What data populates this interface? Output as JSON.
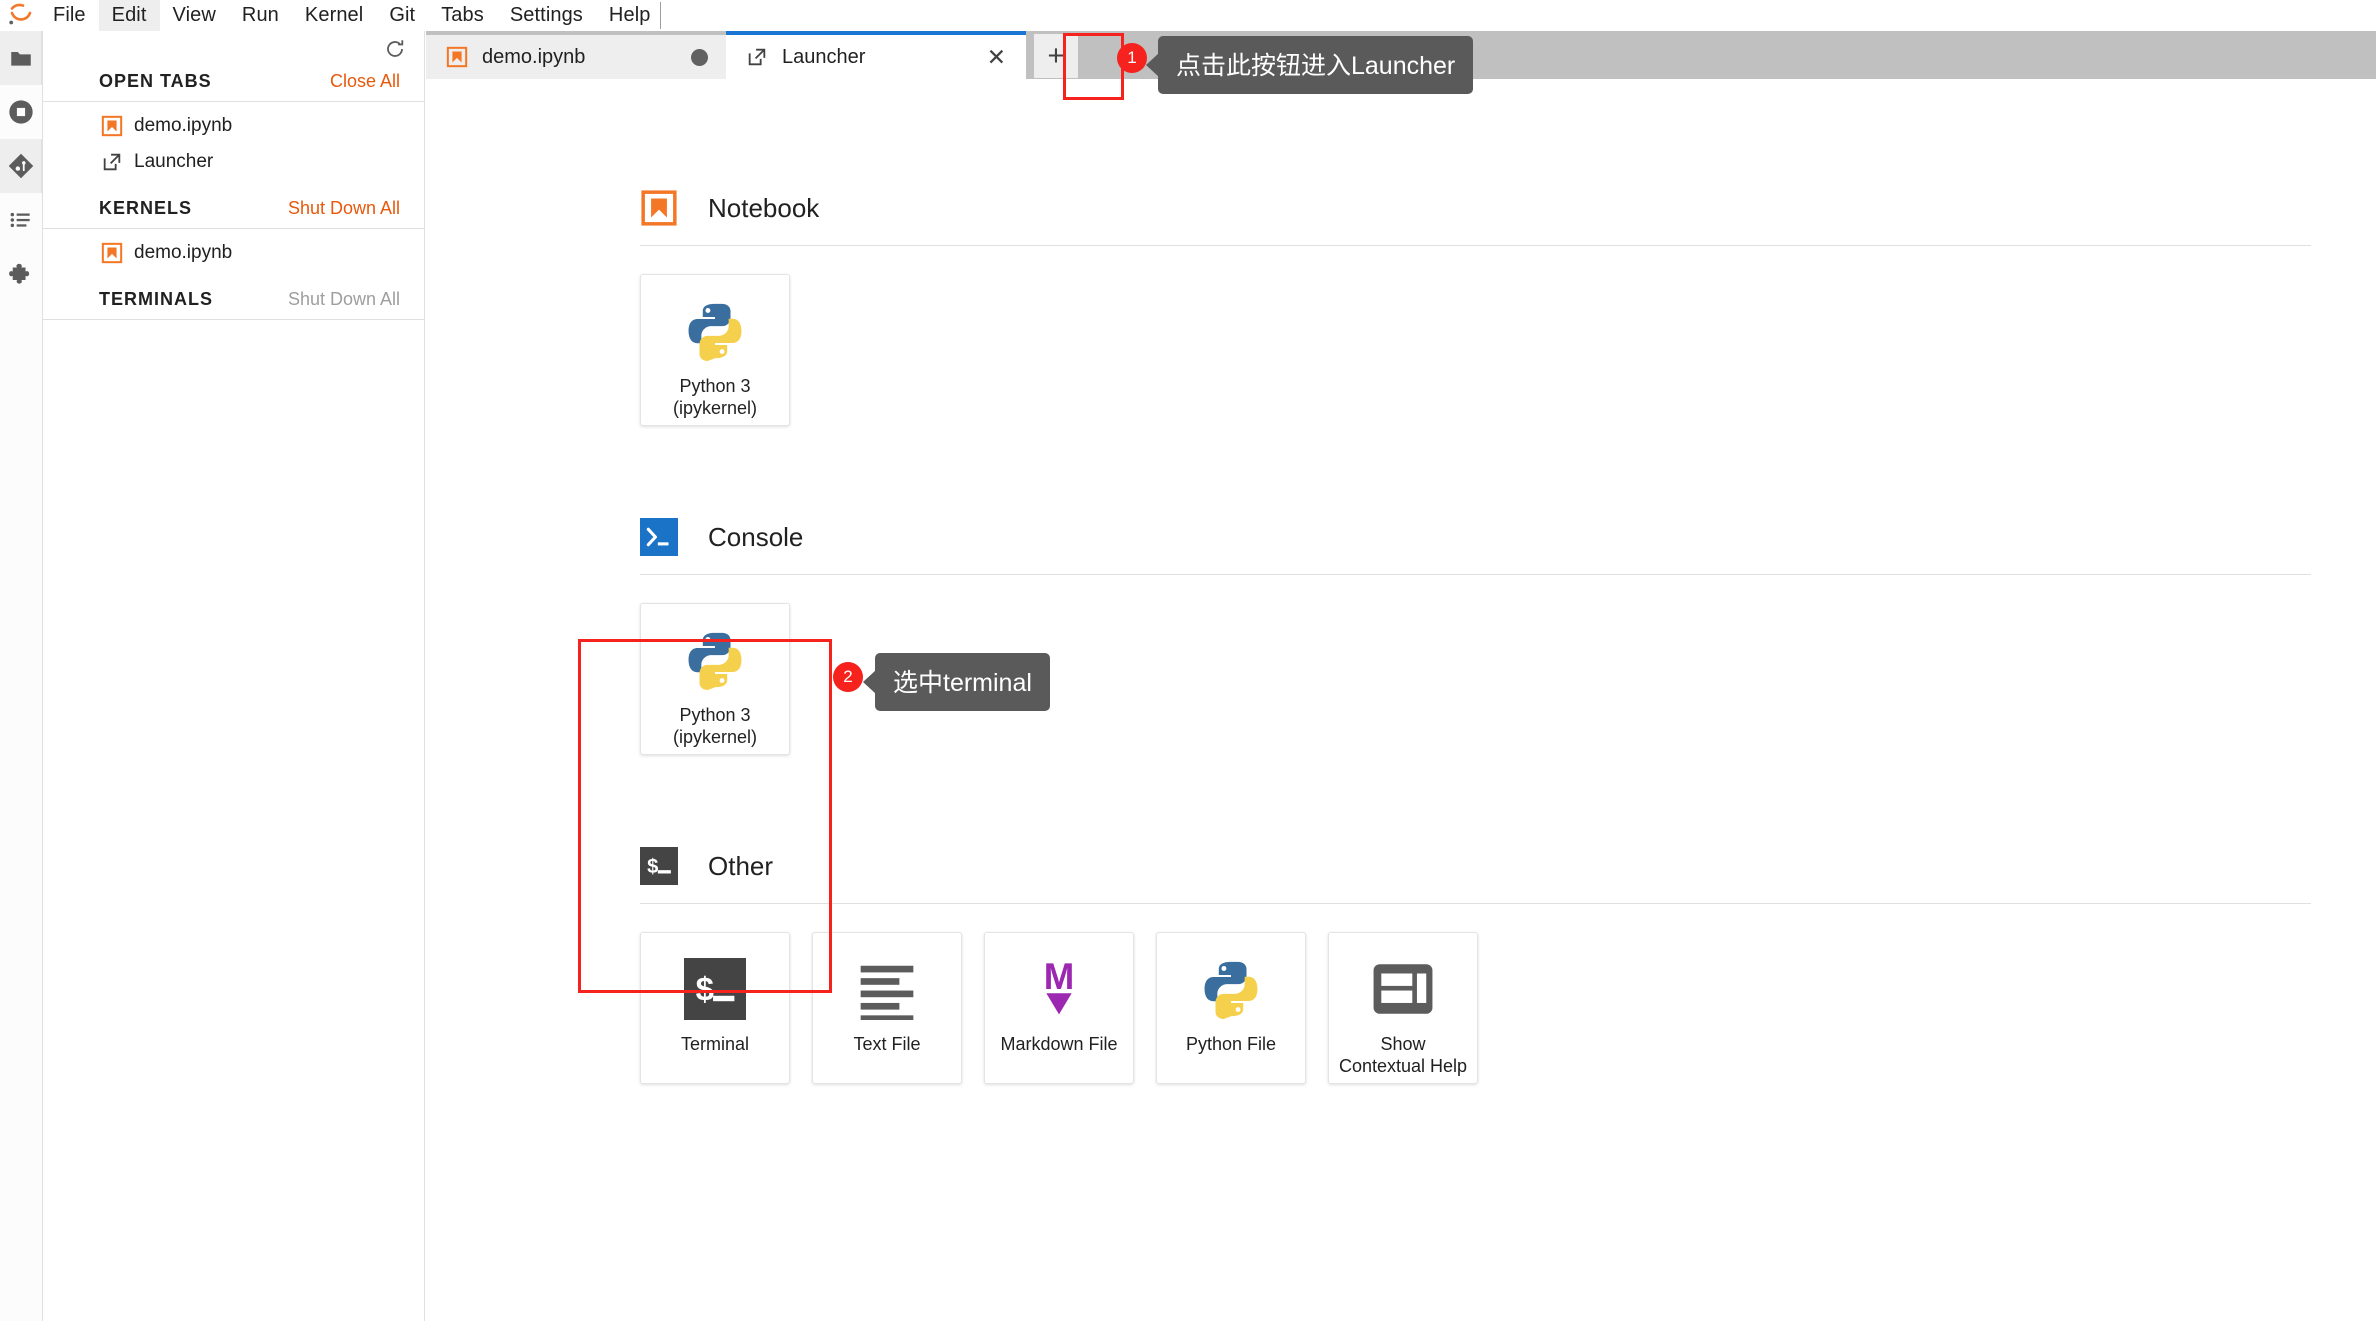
{
  "app": {
    "logo_icon": "jupyter-logo-icon",
    "accent_color": "#e8590c",
    "tab_active_color": "#1976d2",
    "annotation_color": "#f5221e"
  },
  "menubar": {
    "items": [
      {
        "label": "File",
        "name": "menu-file",
        "active": false
      },
      {
        "label": "Edit",
        "name": "menu-edit",
        "active": true
      },
      {
        "label": "View",
        "name": "menu-view",
        "active": false
      },
      {
        "label": "Run",
        "name": "menu-run",
        "active": false
      },
      {
        "label": "Kernel",
        "name": "menu-kernel",
        "active": false
      },
      {
        "label": "Git",
        "name": "menu-git",
        "active": false
      },
      {
        "label": "Tabs",
        "name": "menu-tabs",
        "active": false
      },
      {
        "label": "Settings",
        "name": "menu-settings",
        "active": false
      },
      {
        "label": "Help",
        "name": "menu-help",
        "active": false
      }
    ]
  },
  "rail": {
    "items": [
      {
        "name": "sidebar-icon-file-browser",
        "icon": "folder-icon",
        "selected": true
      },
      {
        "name": "sidebar-icon-running",
        "icon": "stop-circle-icon",
        "selected": false
      },
      {
        "name": "sidebar-icon-git",
        "icon": "git-icon",
        "selected": true
      },
      {
        "name": "sidebar-icon-table-of-contents",
        "icon": "list-icon",
        "selected": false
      },
      {
        "name": "sidebar-icon-extensions",
        "icon": "puzzle-icon",
        "selected": false
      }
    ]
  },
  "left_panel": {
    "refresh_icon": "refresh-icon",
    "sections": [
      {
        "title": "OPEN TABS",
        "action": "Close All",
        "action_dim": false,
        "items": [
          {
            "label": "demo.ipynb",
            "icon": "notebook-icon"
          },
          {
            "label": "Launcher",
            "icon": "launcher-icon"
          }
        ]
      },
      {
        "title": "KERNELS",
        "action": "Shut Down All",
        "action_dim": false,
        "items": [
          {
            "label": "demo.ipynb",
            "icon": "notebook-icon"
          }
        ]
      },
      {
        "title": "TERMINALS",
        "action": "Shut Down All",
        "action_dim": true,
        "items": []
      }
    ]
  },
  "tabbar": {
    "tabs": [
      {
        "label": "demo.ipynb",
        "icon": "notebook-icon",
        "current": false,
        "dirty": true,
        "closable": false
      },
      {
        "label": "Launcher",
        "icon": "launcher-icon",
        "current": true,
        "dirty": false,
        "closable": true
      }
    ],
    "close_label": "✕",
    "new_tab_label": "+",
    "new_tab_name": "new-launcher-tab-button"
  },
  "launcher": {
    "sections": [
      {
        "title": "Notebook",
        "icon": "notebook-icon",
        "cards": [
          {
            "label": "Python 3\n(ipykernel)",
            "icon": "python-icon",
            "name": "launcher-card-notebook-python3"
          }
        ]
      },
      {
        "title": "Console",
        "icon": "console-icon",
        "cards": [
          {
            "label": "Python 3\n(ipykernel)",
            "icon": "python-icon",
            "name": "launcher-card-console-python3"
          }
        ]
      },
      {
        "title": "Other",
        "icon": "terminal-icon",
        "cards": [
          {
            "label": "Terminal",
            "icon": "terminal-icon",
            "name": "launcher-card-terminal"
          },
          {
            "label": "Text File",
            "icon": "text-file-icon",
            "name": "launcher-card-text-file"
          },
          {
            "label": "Markdown File",
            "icon": "markdown-icon",
            "name": "launcher-card-markdown-file"
          },
          {
            "label": "Python File",
            "icon": "python-icon",
            "name": "launcher-card-python-file"
          },
          {
            "label": "Show Contextual Help",
            "icon": "contextual-help-icon",
            "name": "launcher-card-contextual-help"
          }
        ]
      }
    ]
  },
  "annotations": [
    {
      "badge": "1",
      "tip": "点击此按钮进入Launcher",
      "name": "annotation-step-1"
    },
    {
      "badge": "2",
      "tip": "选中terminal",
      "name": "annotation-step-2"
    }
  ]
}
